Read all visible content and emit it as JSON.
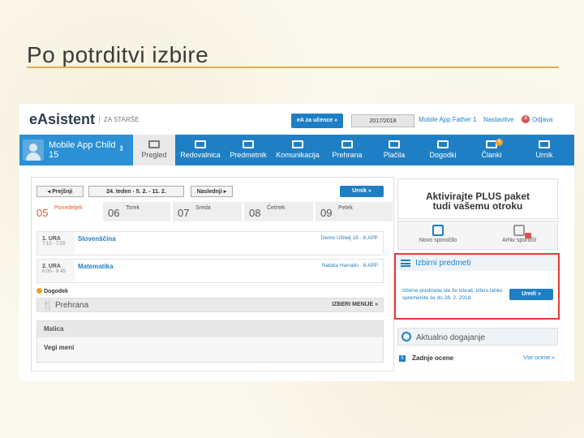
{
  "slide": {
    "title": "Po potrditvi izbire"
  },
  "header": {
    "logo": "eAsistent",
    "logo_sub": "ZA STARŠE",
    "ea_button": "eA za učence »",
    "school_year": "2017/2018",
    "user": "Mobile App Father 1",
    "settings": "Nastavitve",
    "logout": "Odjava"
  },
  "child": {
    "name": "Mobile App Child",
    "number": "15"
  },
  "nav": {
    "items": [
      {
        "label": "Pregled",
        "active": true
      },
      {
        "label": "Redovalnica"
      },
      {
        "label": "Predmetnik"
      },
      {
        "label": "Komunikacija"
      },
      {
        "label": "Prehrana"
      },
      {
        "label": "Plačila"
      },
      {
        "label": "Dogodki"
      },
      {
        "label": "Članki",
        "badge": "5"
      },
      {
        "label": "Urnik"
      }
    ]
  },
  "calendar": {
    "prev": "◂ Prejšnji",
    "week": "24. teden - 5. 2. - 11. 2.",
    "next": "Naslednji ▸",
    "urnik": "Urnik »",
    "days": [
      {
        "num": "05",
        "name": "Ponedeljek",
        "active": true
      },
      {
        "num": "06",
        "name": "Torek"
      },
      {
        "num": "07",
        "name": "Sreda"
      },
      {
        "num": "08",
        "name": "Četrtek"
      },
      {
        "num": "09",
        "name": "Petek"
      }
    ],
    "lessons": [
      {
        "hour": "1. URA",
        "time": "7:10 - 7:55",
        "subject": "Slovenščina",
        "teacher": "Demo Učitelj 18 · 8.APP"
      },
      {
        "hour": "2. URA",
        "time": "8:00 - 8:45",
        "subject": "Matematika",
        "teacher": "Natalia Harrallo · 8.APP"
      }
    ],
    "event": "Dogodek",
    "meal_label": "Prehrana",
    "meal_pick": "IZBERI MENIJE »",
    "malica_title": "Malica",
    "malica_item": "Vegi meni"
  },
  "right": {
    "plus_line1": "Aktivirajte PLUS paket",
    "plus_line2": "tudi vašemu otroku",
    "new_message": "Novo sporočilo",
    "archive": "Arhiv sporočil",
    "elective_title": "Izbirni predmeti",
    "elective_text": "Izbirne predmete ste že izbrali. Izbiro lahko spremenite še do 28. 2. 2018.",
    "edit": "Uredi »",
    "news": "Aktualno dogajanje",
    "grades": "Zadnje ocene",
    "grades_icon": "5",
    "see_all": "Vse ocene »"
  },
  "colors": {
    "brand": "#1e7fc4",
    "accent": "#e05a2a",
    "highlight": "#e53935",
    "rule": "#e0b04c"
  }
}
